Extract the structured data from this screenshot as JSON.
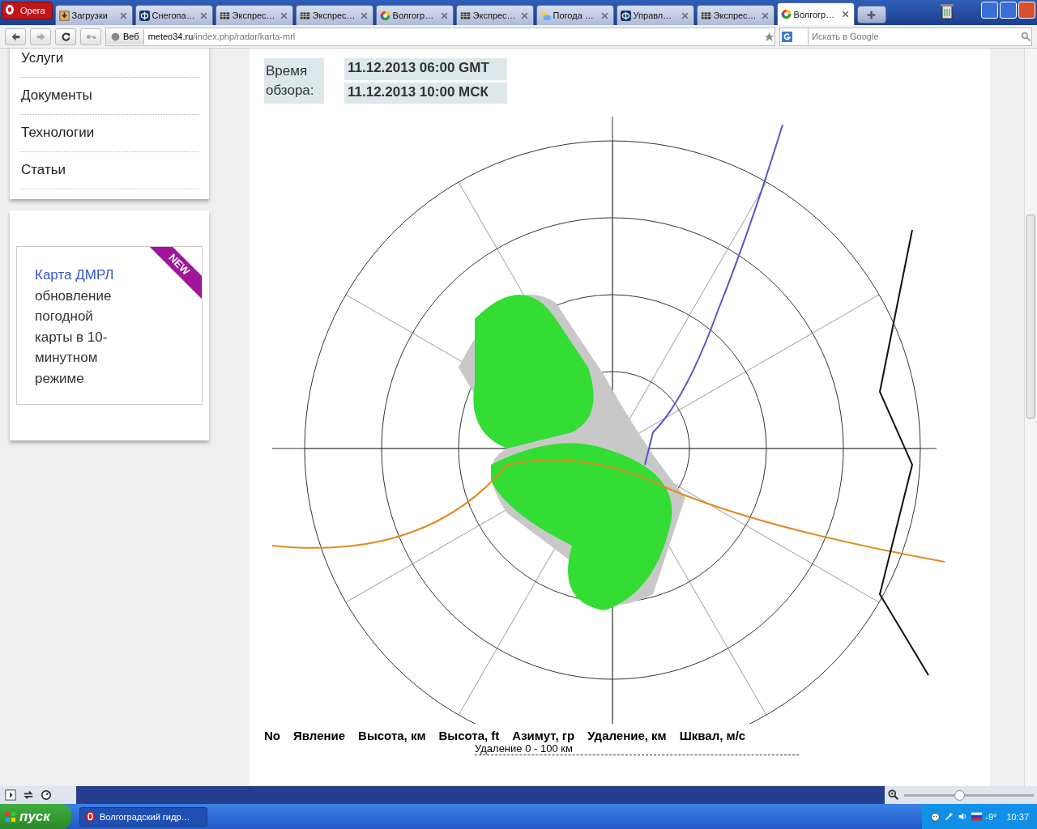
{
  "browser": {
    "menu_button": "Opera",
    "tabs": [
      {
        "label": "Загрузки",
        "kind": "download",
        "selected": false
      },
      {
        "label": "Снегопа…",
        "kind": "letter",
        "selected": false
      },
      {
        "label": "Экспрес…",
        "kind": "grid",
        "selected": false
      },
      {
        "label": "Экспрес…",
        "kind": "grid",
        "selected": false
      },
      {
        "label": "Волгогр…",
        "kind": "ball",
        "selected": false
      },
      {
        "label": "Экспрес…",
        "kind": "grid",
        "selected": false
      },
      {
        "label": "Погода …",
        "kind": "cloud",
        "selected": false
      },
      {
        "label": "Управл…",
        "kind": "letter",
        "selected": false
      },
      {
        "label": "Экспрес…",
        "kind": "grid",
        "selected": false
      },
      {
        "label": "Волгогр…",
        "kind": "ball",
        "selected": true
      }
    ],
    "address": {
      "badge": "Веб",
      "host": "meteo34.ru",
      "path": "/index.php/radar/karta-mrl"
    },
    "search": {
      "placeholder": "Искать в Google"
    },
    "zoom": {
      "level": 0.42
    }
  },
  "sidebar": {
    "menu": [
      {
        "label": "Услуги"
      },
      {
        "label": "Документы"
      },
      {
        "label": "Технологии"
      },
      {
        "label": "Статьи"
      }
    ],
    "promo": {
      "ribbon": "NEW",
      "link": "Карта ДМРЛ",
      "text": "обновление погодной карты в 10-минутном режиме"
    }
  },
  "radar": {
    "time_label": "Время обзора:",
    "gmt": "11.12.2013 06:00 GMT",
    "msk": "11.12.2013 10:00 МСК"
  },
  "table": {
    "columns": [
      "No",
      "Явление",
      "Высота, км",
      "Высота, ft",
      "Азимут, гр",
      "Удаление, км",
      "Шквал, м/с"
    ],
    "section": "Удаление 0 - 100 км"
  },
  "taskbar": {
    "start": "пуск",
    "windows": [
      {
        "label": "Волгоградский гидр…",
        "selected": false
      }
    ],
    "temperature": "-9°",
    "clock": "10:37"
  }
}
